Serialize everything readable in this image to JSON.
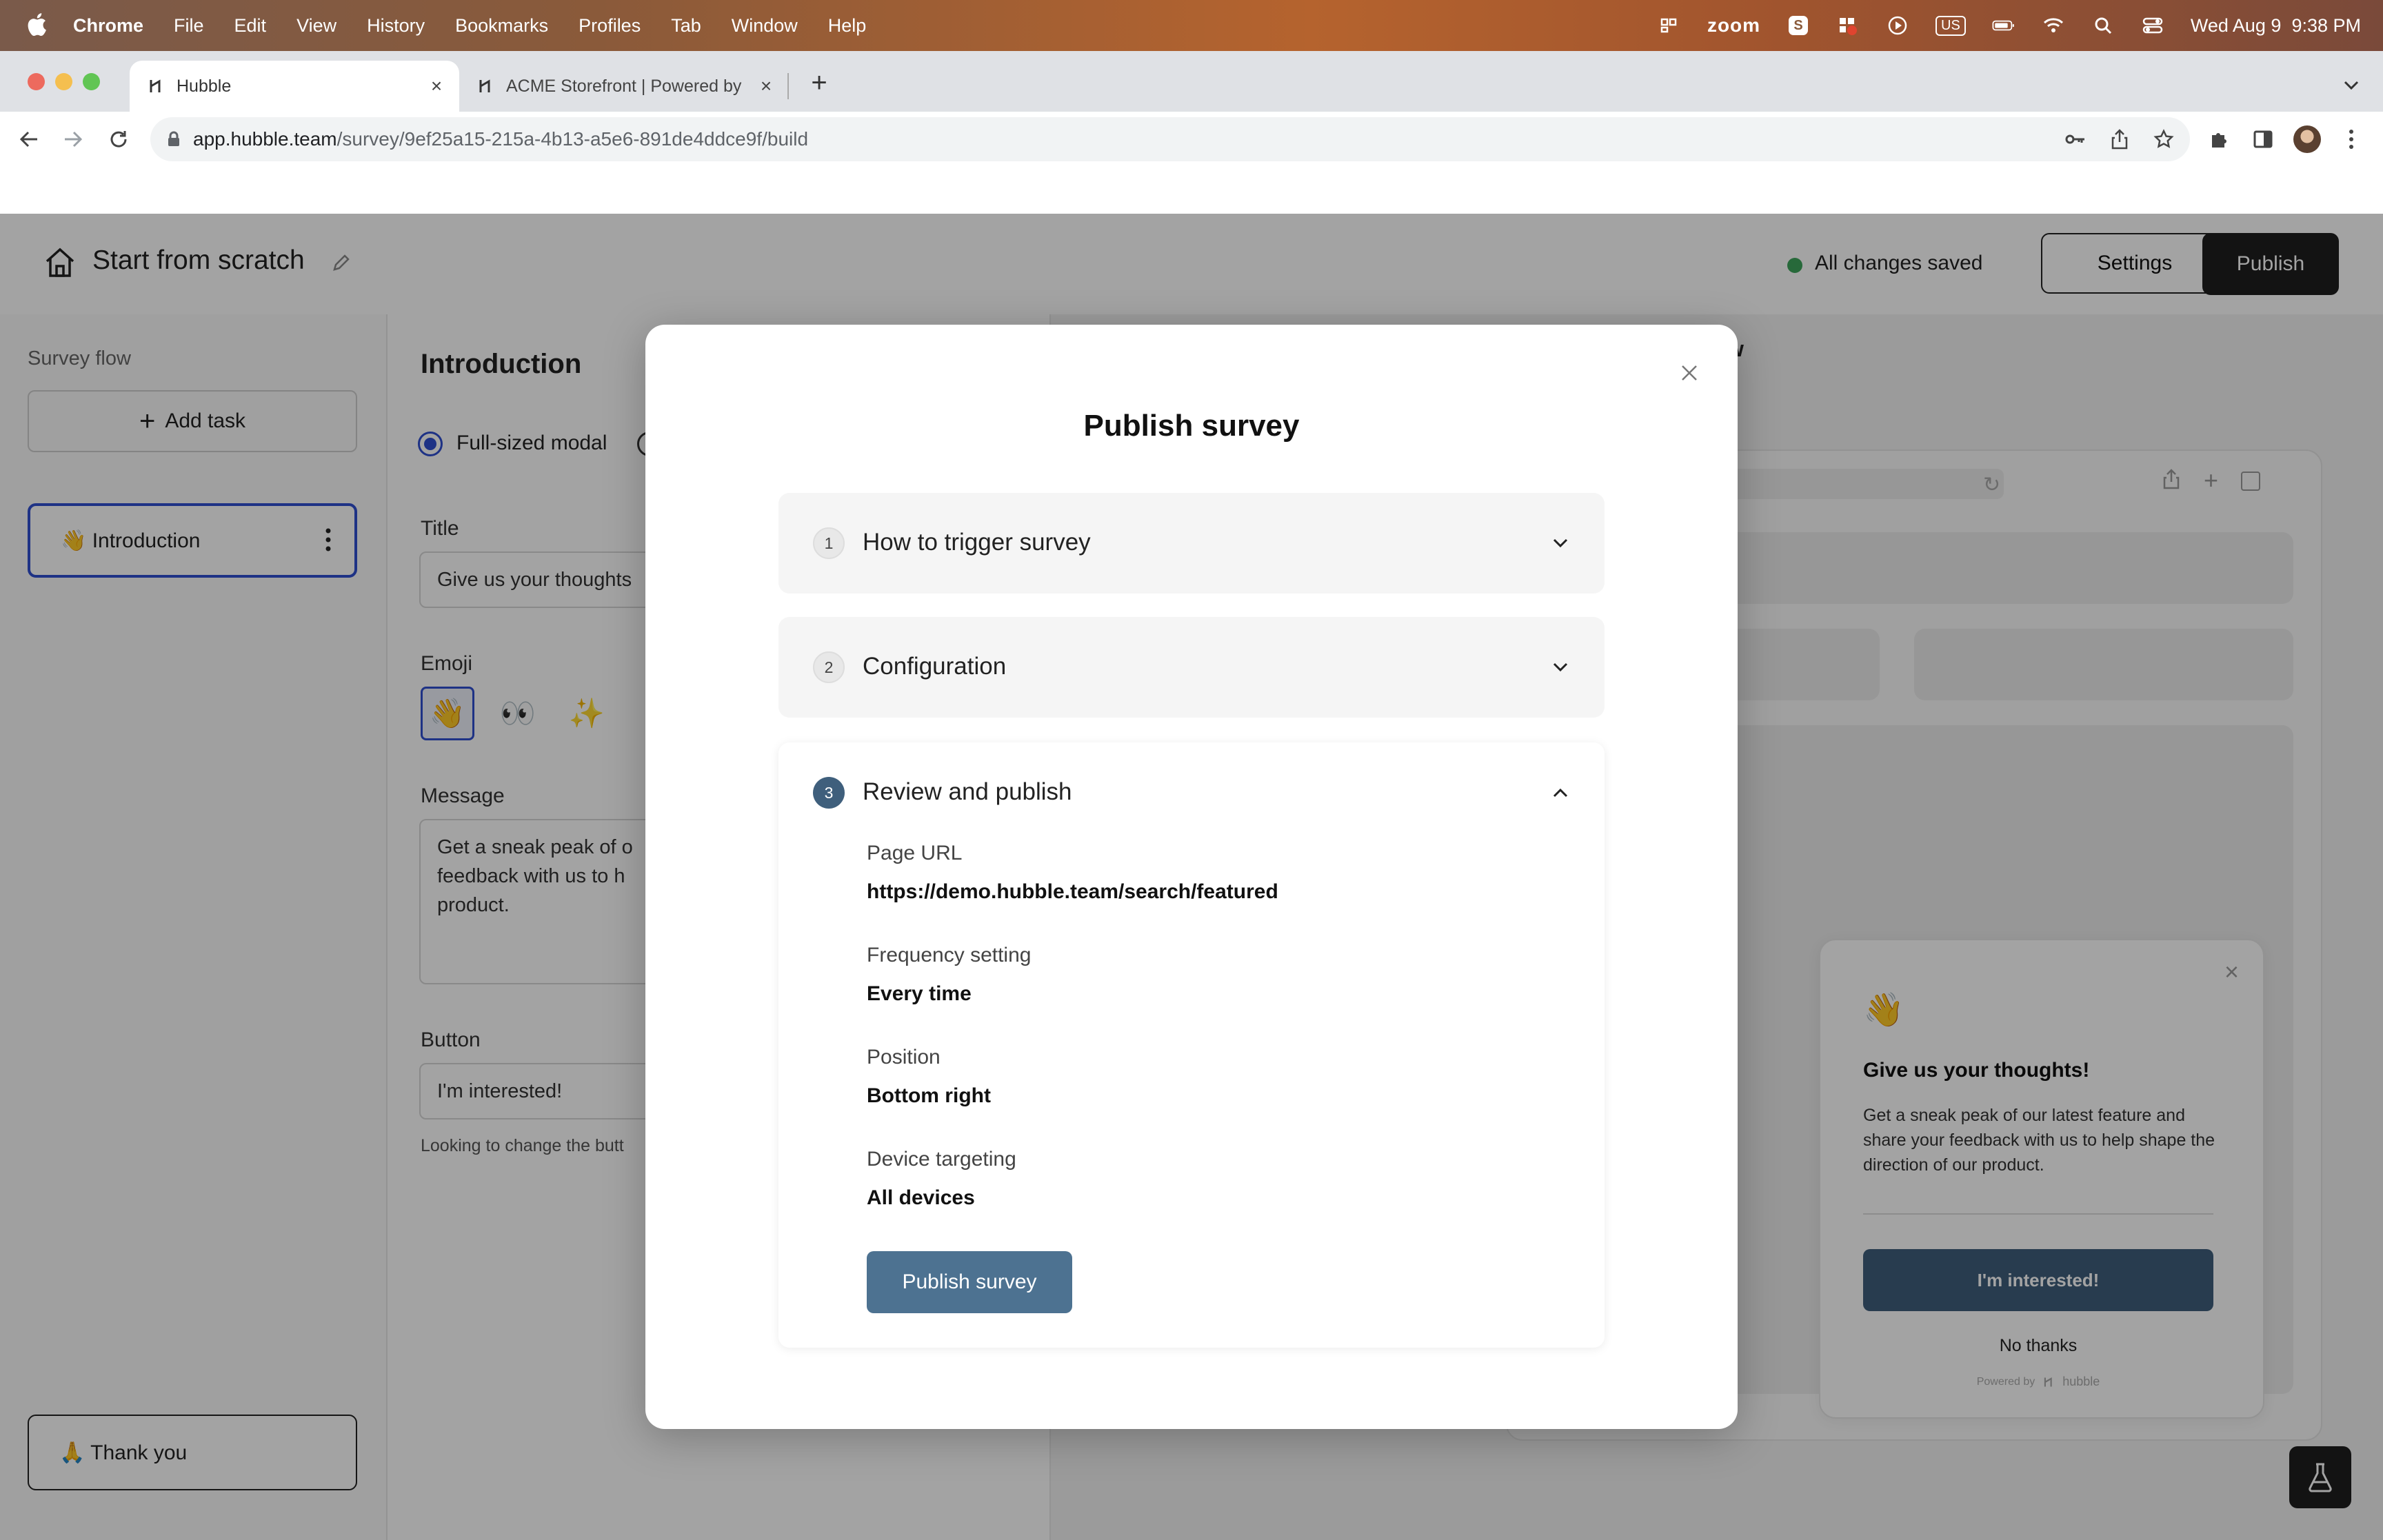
{
  "menubar": {
    "app_name": "Chrome",
    "menus": [
      "File",
      "Edit",
      "View",
      "History",
      "Bookmarks",
      "Profiles",
      "Tab",
      "Window",
      "Help"
    ],
    "zoom_label": "zoom",
    "input_source": "US",
    "datetime": "Wed Aug 9  9:38 PM"
  },
  "browser": {
    "tabs": [
      {
        "title": "Hubble",
        "active": true
      },
      {
        "title": "ACME Storefront | Powered by",
        "active": false
      }
    ],
    "url_host": "app.hubble.team",
    "url_path": "/survey/9ef25a15-215a-4b13-a5e6-891de4ddce9f/build"
  },
  "app": {
    "header": {
      "title": "Start from scratch",
      "save_status": "All changes saved",
      "settings_label": "Settings",
      "publish_label": "Publish"
    },
    "sidebar": {
      "section_label": "Survey flow",
      "add_task_label": "Add task",
      "tasks": [
        {
          "label": "👋 Introduction",
          "selected": true
        },
        {
          "label": "🙏 Thank you",
          "selected": false
        }
      ]
    },
    "editor": {
      "heading": "Introduction",
      "display_option": "Full-sized modal",
      "title_label": "Title",
      "title_value": "Give us your thoughts",
      "emoji_label": "Emoji",
      "emojis": [
        "👋",
        "👀",
        "✨"
      ],
      "message_label": "Message",
      "message_value": "Get a sneak peak of o feedback with us to h product.",
      "button_label": "Button",
      "button_value": "I'm interested!",
      "hint": "Looking to change the butt"
    },
    "preview": {
      "heading_fragment": "w",
      "card": {
        "emoji": "👋",
        "title": "Give us your thoughts!",
        "message": "Get a sneak peak of our latest feature and share your feedback with us to help shape the direction of our product.",
        "cta": "I'm interested!",
        "dismiss": "No thanks",
        "powered_by": "Powered by",
        "brand": "hubble"
      }
    }
  },
  "modal": {
    "title": "Publish survey",
    "steps": [
      {
        "number": "1",
        "title": "How to trigger survey",
        "expanded": false
      },
      {
        "number": "2",
        "title": "Configuration",
        "expanded": false
      },
      {
        "number": "3",
        "title": "Review and publish",
        "expanded": true
      }
    ],
    "review": [
      {
        "label": "Page URL",
        "value": "https://demo.hubble.team/search/featured"
      },
      {
        "label": "Frequency setting",
        "value": "Every time"
      },
      {
        "label": "Position",
        "value": "Bottom right"
      },
      {
        "label": "Device targeting",
        "value": "All devices"
      }
    ],
    "publish_button": "Publish survey"
  },
  "colors": {
    "accent": "#4d7291",
    "step_active": "#3f5f7c",
    "publish_dark": "#1f1f1f",
    "saved_dot": "#3ea55c",
    "selected_border": "#2f4fd1"
  }
}
